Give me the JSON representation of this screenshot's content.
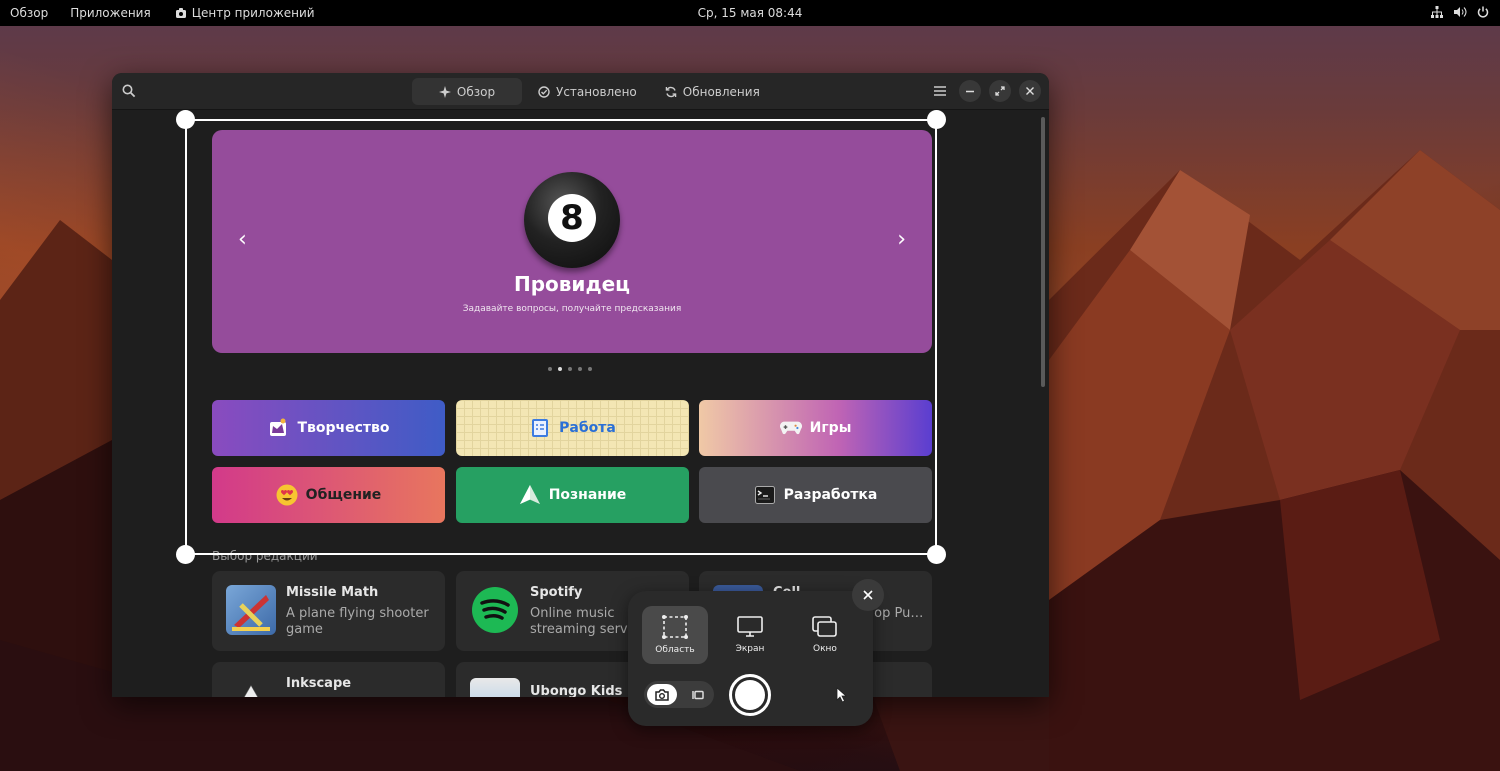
{
  "topbar": {
    "overview": "Обзор",
    "apps": "Приложения",
    "app_center": "Центр приложений",
    "clock": "Ср, 15 мая  08:44",
    "tray": [
      "network-icon",
      "volume-icon",
      "power-icon"
    ]
  },
  "window": {
    "tabs": [
      {
        "label": "Обзор",
        "icon": "sparkle-icon",
        "active": true
      },
      {
        "label": "Установлено",
        "icon": "check-circle-icon",
        "active": false
      },
      {
        "label": "Обновления",
        "icon": "refresh-icon",
        "active": false
      }
    ],
    "banner": {
      "title": "Провидец",
      "subtitle": "Задавайте вопросы, получайте предсказания",
      "ball_digit": "8",
      "color": "#954c9b",
      "active_dot": 1,
      "dot_count": 5
    },
    "categories": [
      {
        "label": "Творчество",
        "icon": "paint-icon",
        "style": "linear-gradient(90deg,#8a4bbf,#3f5cc6)"
      },
      {
        "label": "Работа",
        "icon": "clipboard-icon",
        "style": "#f3e6b4",
        "text_color": "#2a6fd6"
      },
      {
        "label": "Игры",
        "icon": "gamepad-icon",
        "style": "linear-gradient(90deg,#f0c9a6,#c064b4 60%,#5a3ed0)"
      },
      {
        "label": "Общение",
        "icon": "heart-eyes-emoji-icon",
        "style": "linear-gradient(90deg,#d23a8a,#e8765e)",
        "text_color": "#222"
      },
      {
        "label": "Познание",
        "icon": "paper-plane-icon",
        "style": "#26a062"
      },
      {
        "label": "Разработка",
        "icon": "terminal-icon",
        "style": "#4a4a4e"
      }
    ],
    "section_title": "Выбор редакции",
    "cards": [
      {
        "name": "Missile Math",
        "desc": "A plane flying shooter game"
      },
      {
        "name": "Spotify",
        "desc": "Online music streaming service"
      },
      {
        "name": "Coll",
        "desc": "e… op Pu…"
      },
      {
        "name": "Inkscape",
        "desc": ""
      },
      {
        "name": "Ubongo Kids Lite",
        "desc": ""
      }
    ]
  },
  "screenshot_tool": {
    "modes": [
      {
        "label": "Область",
        "icon": "region-select-icon",
        "active": true
      },
      {
        "label": "Экран",
        "icon": "monitor-icon",
        "active": false
      },
      {
        "label": "Окно",
        "icon": "window-icon",
        "active": false
      }
    ],
    "capture_type": "screenshot"
  }
}
